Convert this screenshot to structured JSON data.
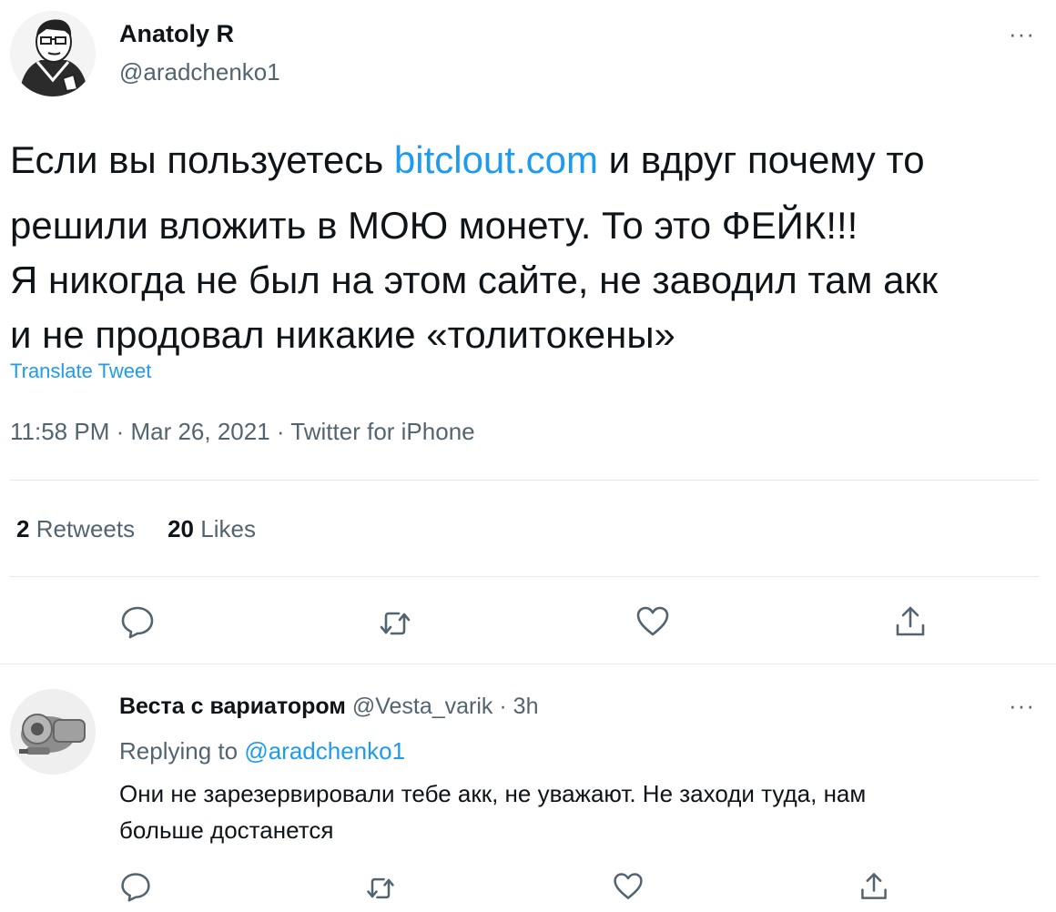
{
  "tweet": {
    "author_name": "Anatoly R",
    "author_handle": "@aradchenko1",
    "more": "···",
    "text_line1_before": "Если вы пользуетесь ",
    "text_link": "bitclout.com",
    "text_line1_after": " и вдруг почему то",
    "text_line2": "решили вложить в МОЮ монету. То это ФЕЙК!!!",
    "text_line3": "Я никогда не был на этом сайте, не заводил там акк",
    "text_line4": "и не продовал никакие «толитокены»",
    "translate": "Translate Tweet",
    "timestamp": "11:58 PM · Mar 26, 2021 · Twitter for iPhone",
    "retweets_count": "2",
    "retweets_label": "Retweets",
    "likes_count": "20",
    "likes_label": "Likes"
  },
  "reply": {
    "author_name": "Веста с вариатором",
    "author_handle": "@Vesta_varik",
    "separator": "·",
    "time": "3h",
    "more": "···",
    "replying_prefix": "Replying to",
    "replying_to": "@aradchenko1",
    "text_line1": "Они не зарезервировали тебе акк, не уважают. Не заходи туда, нам",
    "text_line2": "больше достанется"
  },
  "icons": {
    "reply": "reply-icon",
    "retweet": "retweet-icon",
    "like": "heart-icon",
    "share": "share-icon"
  },
  "colors": {
    "link": "#1d9bf0",
    "secondary_text": "#536471",
    "primary_text": "#0f1419",
    "divider": "#e6e9eb"
  }
}
